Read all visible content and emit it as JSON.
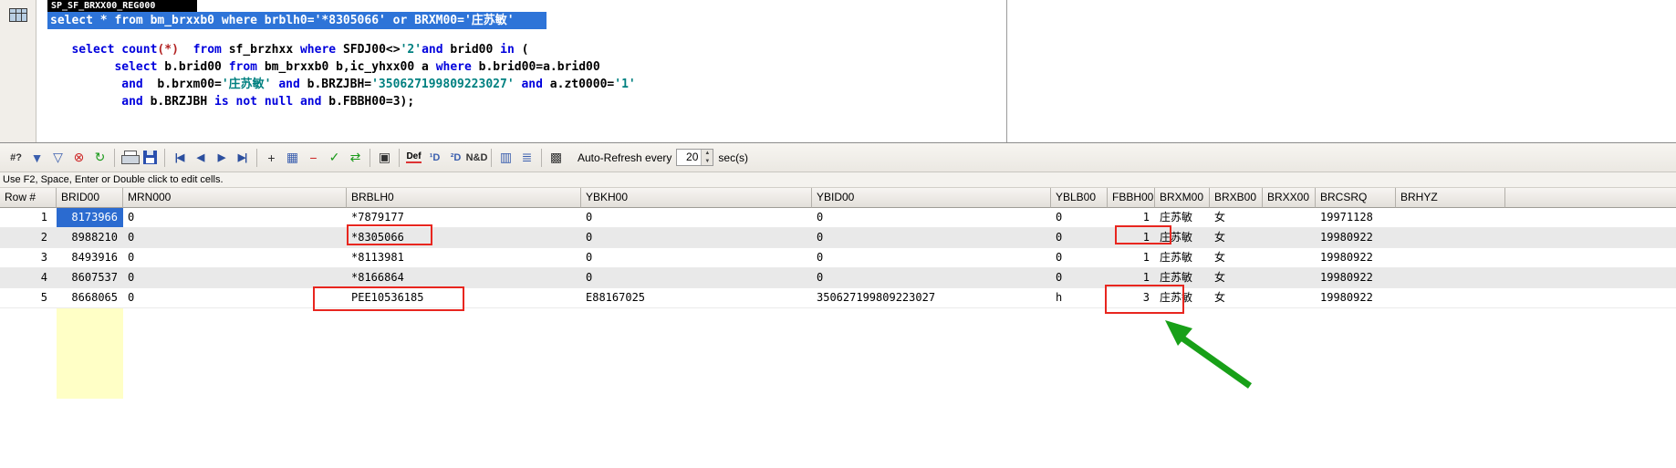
{
  "window": {
    "title": "SP_SF_BRXX00_REG000"
  },
  "editor": {
    "selected_line": "select * from bm_brxxb0 where brblh0='*8305066' or BRXM00='庄苏敏'",
    "lines": [
      {
        "tokens": [
          {
            "t": "   "
          },
          {
            "t": "select "
          },
          {
            "t": "count"
          },
          {
            "t": "(*)"
          },
          {
            "t": "  "
          },
          {
            "t": "from "
          },
          {
            "t": "sf_brzhxx "
          },
          {
            "t": "where "
          },
          {
            "t": "SFDJ00<>"
          },
          {
            "t": "'2'"
          },
          {
            "t": "and "
          },
          {
            "t": "brid00 "
          },
          {
            "t": "in "
          },
          {
            "t": "("
          }
        ]
      },
      {
        "tokens": [
          {
            "t": "         "
          },
          {
            "t": "select "
          },
          {
            "t": "b.brid00 "
          },
          {
            "t": "from "
          },
          {
            "t": "bm_brxxb0 b,ic_yhxx00 a "
          },
          {
            "t": "where "
          },
          {
            "t": "b.brid00=a.brid00"
          }
        ]
      },
      {
        "tokens": [
          {
            "t": "          "
          },
          {
            "t": "and"
          },
          {
            "t": "  b.brxm00="
          },
          {
            "t": "'庄苏敏'"
          },
          {
            "t": " "
          },
          {
            "t": "and "
          },
          {
            "t": "b.BRZJBH="
          },
          {
            "t": "'350627199809223027'"
          },
          {
            "t": " "
          },
          {
            "t": "and "
          },
          {
            "t": "a.zt0000="
          },
          {
            "t": "'1'"
          }
        ]
      },
      {
        "tokens": [
          {
            "t": "          "
          },
          {
            "t": "and "
          },
          {
            "t": "b.BRZJBH "
          },
          {
            "t": "is not null "
          },
          {
            "t": "and "
          },
          {
            "t": "b.FBBH00=3);"
          }
        ]
      }
    ]
  },
  "toolbar": {
    "icons": [
      {
        "name": "row-count-icon",
        "glyph": "#?"
      },
      {
        "name": "filter-icon",
        "glyph": "▼"
      },
      {
        "name": "clear-filter-icon",
        "glyph": "▽"
      },
      {
        "name": "cancel-query-icon",
        "glyph": "⊗"
      },
      {
        "name": "refresh-icon",
        "glyph": "↻"
      },
      {
        "name": "print-icon",
        "glyph": ""
      },
      {
        "name": "save-icon",
        "glyph": ""
      },
      {
        "name": "first-record-icon",
        "glyph": "|◀"
      },
      {
        "name": "prior-record-icon",
        "glyph": "◀"
      },
      {
        "name": "next-record-icon",
        "glyph": "▶"
      },
      {
        "name": "last-record-icon",
        "glyph": "▶|"
      },
      {
        "name": "add-record-icon",
        "glyph": "+"
      },
      {
        "name": "insert-record-icon",
        "glyph": "▦"
      },
      {
        "name": "delete-record-icon",
        "glyph": "−"
      },
      {
        "name": "post-edits-icon",
        "glyph": "✓"
      },
      {
        "name": "refresh-grid-icon",
        "glyph": "⇄"
      },
      {
        "name": "picture-icon",
        "glyph": "▣"
      },
      {
        "name": "default-format-icon",
        "glyph": "Def"
      },
      {
        "name": "date-format-icon",
        "glyph": "¹D"
      },
      {
        "name": "numeric-format-icon",
        "glyph": "²D"
      },
      {
        "name": "date-time-format-icon",
        "glyph": "N&D"
      },
      {
        "name": "grid-view-icon",
        "glyph": "▥"
      },
      {
        "name": "record-view-icon",
        "glyph": "≣"
      },
      {
        "name": "grid-options-icon",
        "glyph": "▩"
      }
    ],
    "auto_refresh_label": "Auto-Refresh every",
    "interval": "20",
    "unit": "sec(s)",
    "spinner_up": "▲",
    "spinner_down": "▼"
  },
  "hint": "Use F2, Space, Enter or Double click to edit cells.",
  "grid": {
    "columns": [
      "Row #",
      "BRID00",
      "MRN000",
      "BRBLH0",
      "YBKH00",
      "YBID00",
      "YBLB00",
      "FBBH00",
      "BRXM00",
      "BRXB00",
      "BRXX00",
      "BRCSRQ",
      "BRHYZ"
    ],
    "rows": [
      {
        "row": "1",
        "BRID00": "8173966",
        "MRN000": "0",
        "BRBLH0": "*7879177",
        "YBKH00": "0",
        "YBID00": "0",
        "YBLB00": "0",
        "FBBH00": "1",
        "BRXM00": "庄苏敏",
        "BRXB00": "女",
        "BRXX00": "",
        "BRCSRQ": "19971128",
        "BRHYZ": ""
      },
      {
        "row": "2",
        "BRID00": "8988210",
        "MRN000": "0",
        "BRBLH0": "*8305066",
        "YBKH00": "0",
        "YBID00": "0",
        "YBLB00": "0",
        "FBBH00": "1",
        "BRXM00": "庄苏敏",
        "BRXB00": "女",
        "BRXX00": "",
        "BRCSRQ": "19980922",
        "BRHYZ": ""
      },
      {
        "row": "3",
        "BRID00": "8493916",
        "MRN000": "0",
        "BRBLH0": "*8113981",
        "YBKH00": "0",
        "YBID00": "0",
        "YBLB00": "0",
        "FBBH00": "1",
        "BRXM00": "庄苏敏",
        "BRXB00": "女",
        "BRXX00": "",
        "BRCSRQ": "19980922",
        "BRHYZ": ""
      },
      {
        "row": "4",
        "BRID00": "8607537",
        "MRN000": "0",
        "BRBLH0": "*8166864",
        "YBKH00": "0",
        "YBID00": "0",
        "YBLB00": "0",
        "FBBH00": "1",
        "BRXM00": "庄苏敏",
        "BRXB00": "女",
        "BRXX00": "",
        "BRCSRQ": "19980922",
        "BRHYZ": ""
      },
      {
        "row": "5",
        "BRID00": "8668065",
        "MRN000": "0",
        "BRBLH0": "PEE10536185",
        "YBKH00": "E88167025",
        "YBID00": "350627199809223027",
        "YBLB00": "h",
        "FBBH00": "3",
        "BRXM00": "庄苏敏",
        "BRXB00": "女",
        "BRXX00": "",
        "BRCSRQ": "19980922",
        "BRHYZ": ""
      }
    ]
  },
  "colors": {
    "selection_blue": "#2e74d8",
    "keyword_blue": "#0000dd",
    "string_teal": "#008080",
    "selected_cell_blue": "#2b6bd0",
    "annotation_red": "#e8261f",
    "arrow_green": "#18a018",
    "column_highlight_yellow": "#ffffc6"
  }
}
